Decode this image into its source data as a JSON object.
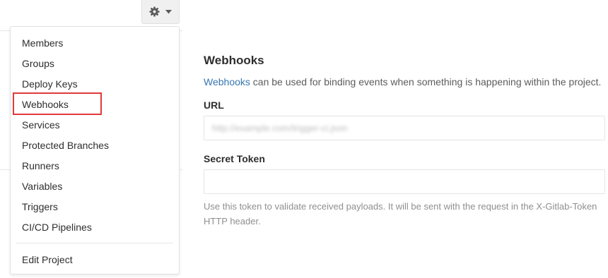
{
  "settings_toggle": {
    "icon": "gear-icon",
    "caret": "caret-down-icon"
  },
  "menu": {
    "items": [
      {
        "label": "Members"
      },
      {
        "label": "Groups"
      },
      {
        "label": "Deploy Keys"
      },
      {
        "label": "Webhooks",
        "highlighted": true
      },
      {
        "label": "Services"
      },
      {
        "label": "Protected Branches"
      },
      {
        "label": "Runners"
      },
      {
        "label": "Variables"
      },
      {
        "label": "Triggers"
      },
      {
        "label": "CI/CD Pipelines"
      }
    ],
    "footer_item": {
      "label": "Edit Project"
    },
    "highlight_color": "#e03a3a"
  },
  "main": {
    "title": "Webhooks",
    "description_link": "Webhooks",
    "description_rest": " can be used for binding events when something is happening within the project.",
    "url_label": "URL",
    "url_placeholder": "http://example.com/trigger-ci.json",
    "token_label": "Secret Token",
    "token_value": "",
    "help_text": "Use this token to validate received payloads. It will be sent with the request in the X-Gitlab-Token HTTP header."
  },
  "colors": {
    "link": "#3777b0",
    "text": "#2e2e2e",
    "muted": "#8f8f8f"
  }
}
